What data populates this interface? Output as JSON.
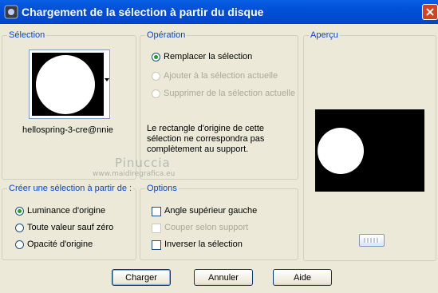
{
  "window": {
    "title": "Chargement de la sélection à partir du disque"
  },
  "selection": {
    "group_label": "Sélection",
    "filename": "hellospring-3-cre@nnie"
  },
  "operation": {
    "group_label": "Opération",
    "options": [
      {
        "label": "Remplacer la sélection",
        "checked": true,
        "enabled": true
      },
      {
        "label": "Ajouter à la sélection actuelle",
        "checked": false,
        "enabled": false
      },
      {
        "label": "Supprimer de la sélection actuelle",
        "checked": false,
        "enabled": false
      }
    ],
    "message_lines": [
      "Le rectangle d'origine de cette",
      "sélection ne correspondra pas",
      "complètement au support."
    ]
  },
  "preview": {
    "group_label": "Aperçu"
  },
  "create_from": {
    "group_label": "Créer une sélection à partir de :",
    "options": [
      {
        "label": "Luminance d'origine",
        "checked": true
      },
      {
        "label": "Toute valeur sauf zéro",
        "checked": false
      },
      {
        "label": "Opacité d'origine",
        "checked": false
      }
    ]
  },
  "options": {
    "group_label": "Options",
    "items": [
      {
        "label": "Angle supérieur gauche",
        "checked": false,
        "enabled": true
      },
      {
        "label": "Couper selon support",
        "checked": false,
        "enabled": false
      },
      {
        "label": "Inverser la sélection",
        "checked": false,
        "enabled": true
      }
    ]
  },
  "buttons": {
    "load": "Charger",
    "cancel": "Annuler",
    "help": "Aide"
  },
  "watermark": {
    "name": "Pinuccia",
    "url": "www.maidiregrafica.eu"
  },
  "colors": {
    "title_bar": "#0054e3",
    "legend": "#0046d5",
    "close": "#d3431d",
    "radio_dot": "#21a121"
  },
  "icons": {
    "title": "app-icon",
    "close": "close-icon",
    "dropdown": "dropdown-arrow-icon"
  }
}
